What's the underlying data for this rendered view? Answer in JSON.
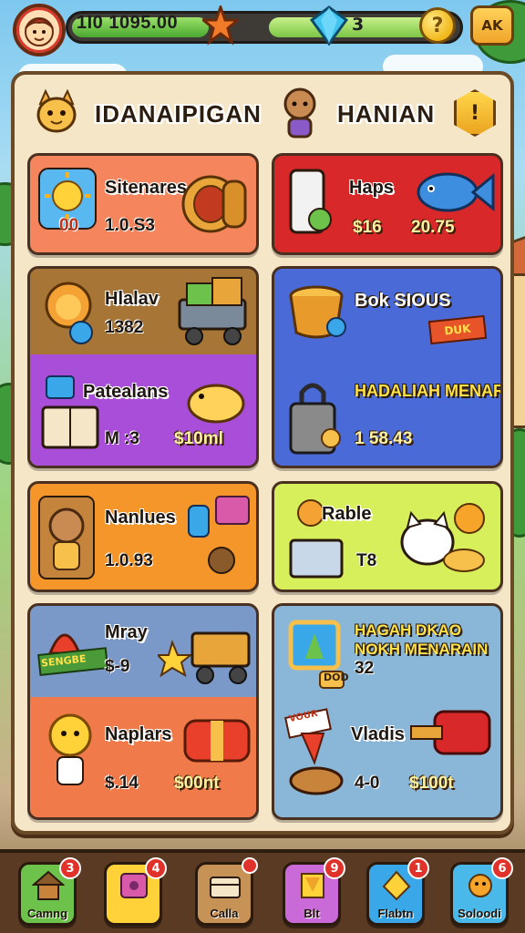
{
  "hud": {
    "coins": "1I0 1095.00",
    "gems": "3",
    "coin_glyph": "?",
    "menu_label": "AK",
    "icons": [
      "avatar-icon",
      "star-icon",
      "gem-icon",
      "coin-icon"
    ]
  },
  "panel": {
    "title_left": "IDANAIPIGAN",
    "title_right": "HANIAN",
    "badge_glyph": "!"
  },
  "cards": [
    {
      "name": "Sitenares",
      "value": "1.0.S3",
      "badge": "00"
    },
    {
      "name": "Haps",
      "value": "$16",
      "value2": "20.75"
    },
    {
      "name": "Hlalav",
      "value": "1382"
    },
    {
      "name": "Patealans",
      "value": "M :3",
      "value2": "$10ml"
    },
    {
      "name": "Bok SIOUS",
      "tag": "DUK"
    },
    {
      "name": "HADALIAH MENARIKK",
      "value": "1 58.43"
    },
    {
      "name": "Nanlues",
      "value": "1.0.93"
    },
    {
      "name": "Rable",
      "value": "T8"
    },
    {
      "name": "Mray",
      "value": "$-9",
      "sign": "SENGBE"
    },
    {
      "name": "HAGAH DKAO NOKH MENARAIN",
      "value": "32",
      "sign": "DOD"
    },
    {
      "name": "Naplars",
      "value": "$.14",
      "value2": "$00nt"
    },
    {
      "name": "Vladis",
      "value": "4-0",
      "value2": "$100t",
      "sign": "VOUR"
    }
  ],
  "nav": [
    {
      "label": "Camng",
      "badge": "3",
      "color": "#6cc24a"
    },
    {
      "label": "",
      "badge": "4",
      "color": "#ffd23a"
    },
    {
      "label": "Calla",
      "badge": "",
      "color": "#c79256"
    },
    {
      "label": "Blt",
      "badge": "9",
      "color": "#c96ad8"
    },
    {
      "label": "Flabtn",
      "badge": "1",
      "color": "#3aa8e8"
    },
    {
      "label": "Soloodi",
      "badge": "6",
      "color": "#4ab8e8"
    }
  ]
}
